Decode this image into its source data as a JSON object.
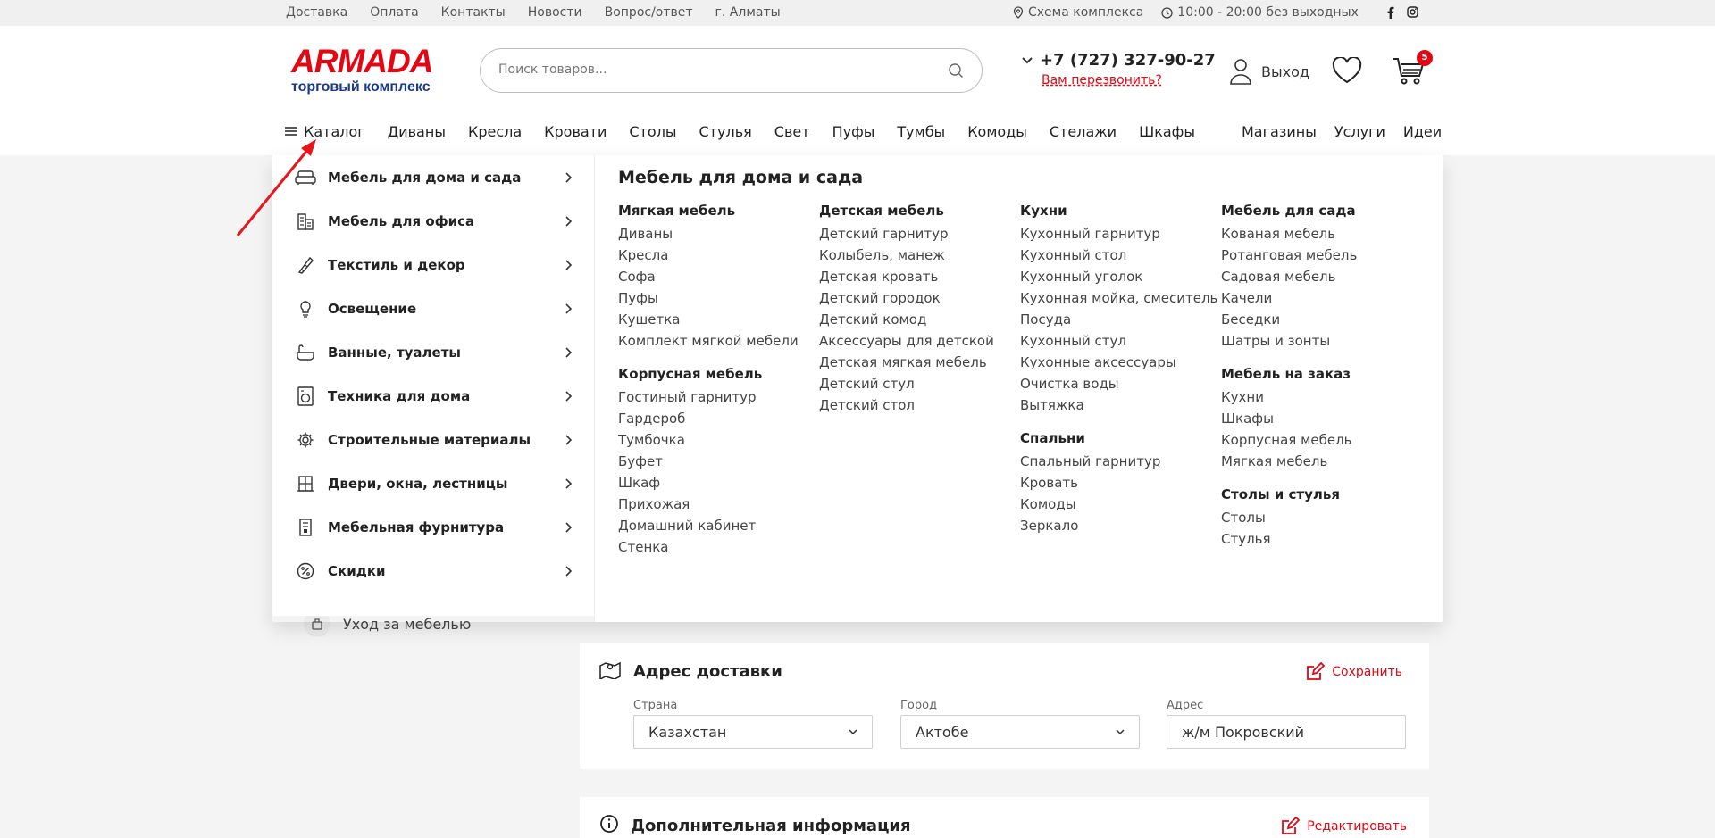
{
  "topbar": {
    "links": [
      "Доставка",
      "Оплата",
      "Контакты",
      "Новости",
      "Вопрос/ответ",
      "г. Алматы"
    ],
    "scheme": "Схема комплекса",
    "hours": "10:00 - 20:00 без выходных",
    "social": [
      "facebook-icon",
      "instagram-icon"
    ]
  },
  "header": {
    "logo_brand": "ARMADA",
    "logo_sub": "торговый комплекс",
    "search_placeholder": "Поиск товаров...",
    "phone": "+7 (727) 327-90-27",
    "callback": "Вам перезвонить?",
    "account": "Выход",
    "cart_count": "5"
  },
  "nav": {
    "catalog": "Каталог",
    "items": [
      "Диваны",
      "Кресла",
      "Кровати",
      "Столы",
      "Стулья",
      "Свет",
      "Пуфы",
      "Тумбы",
      "Комоды",
      "Стелажи",
      "Шкафы"
    ],
    "right": [
      "Магазины",
      "Услуги",
      "Идеи"
    ]
  },
  "catalog_menu": {
    "categories": [
      {
        "label": "Мебель для дома и сада",
        "icon": "sofa-icon"
      },
      {
        "label": "Мебель для офиса",
        "icon": "office-icon"
      },
      {
        "label": "Текстиль и декор",
        "icon": "textile-icon"
      },
      {
        "label": "Освещение",
        "icon": "bulb-icon"
      },
      {
        "label": "Ванные, туалеты",
        "icon": "bathtub-icon"
      },
      {
        "label": "Техника для дома",
        "icon": "appliance-icon"
      },
      {
        "label": "Строительные материалы",
        "icon": "gear-icon"
      },
      {
        "label": "Двери, окна, лестницы",
        "icon": "window-icon"
      },
      {
        "label": "Мебельная фурнитура",
        "icon": "hardware-icon"
      },
      {
        "label": "Скидки",
        "icon": "discount-icon"
      }
    ],
    "title": "Мебель для дома и сада",
    "columns": [
      [
        {
          "heading": "Мягкая мебель",
          "items": [
            "Диваны",
            "Кресла",
            "Софа",
            "Пуфы",
            "Кушетка",
            "Комплект мягкой мебели"
          ]
        },
        {
          "heading": "Корпусная мебель",
          "items": [
            "Гостиный гарнитур",
            "Гардероб",
            "Тумбочка",
            "Буфет",
            "Шкаф",
            "Прихожая",
            "Домашний кабинет",
            "Стенка"
          ]
        }
      ],
      [
        {
          "heading": "Детская мебель",
          "items": [
            "Детский гарнитур",
            "Колыбель, манеж",
            "Детская кровать",
            "Детский городок",
            "Детский комод",
            "Аксессуары для детской",
            "Детская мягкая мебель",
            "Детский стул",
            "Детский стол"
          ]
        }
      ],
      [
        {
          "heading": "Кухни",
          "items": [
            "Кухонный гарнитур",
            "Кухонный стол",
            "Кухонный уголок",
            "Кухонная мойка, смеситель",
            "Посуда",
            "Кухонный стул",
            "Кухонные аксессуары",
            "Очистка воды",
            "Вытяжка"
          ]
        },
        {
          "heading": "Спальни",
          "items": [
            "Спальный гарнитур",
            "Кровать",
            "Комоды",
            "Зеркало"
          ]
        }
      ],
      [
        {
          "heading": "Мебель для сада",
          "items": [
            "Кованая мебель",
            "Ротанговая мебель",
            "Садовая мебель",
            "Качели",
            "Беседки",
            "Шатры и зонты"
          ]
        },
        {
          "heading": "Мебель на заказ",
          "items": [
            "Кухни",
            "Шкафы",
            "Корпусная мебель",
            "Мягкая мебель"
          ]
        },
        {
          "heading": "Столы и стулья",
          "items": [
            "Столы",
            "Стулья"
          ]
        }
      ]
    ]
  },
  "page": {
    "care_link": "Уход за мебелью",
    "address_title": "Адрес доставки",
    "save": "Сохранить",
    "country_label": "Страна",
    "country_value": "Казахстан",
    "city_label": "Город",
    "city_value": "Актобе",
    "address_label": "Адрес",
    "address_value": "ж/м Покровский",
    "extra_title": "Дополнительная информация",
    "edit": "Редактировать"
  },
  "colors": {
    "accent": "#e30613",
    "brand_blue": "#1d3a8a"
  }
}
